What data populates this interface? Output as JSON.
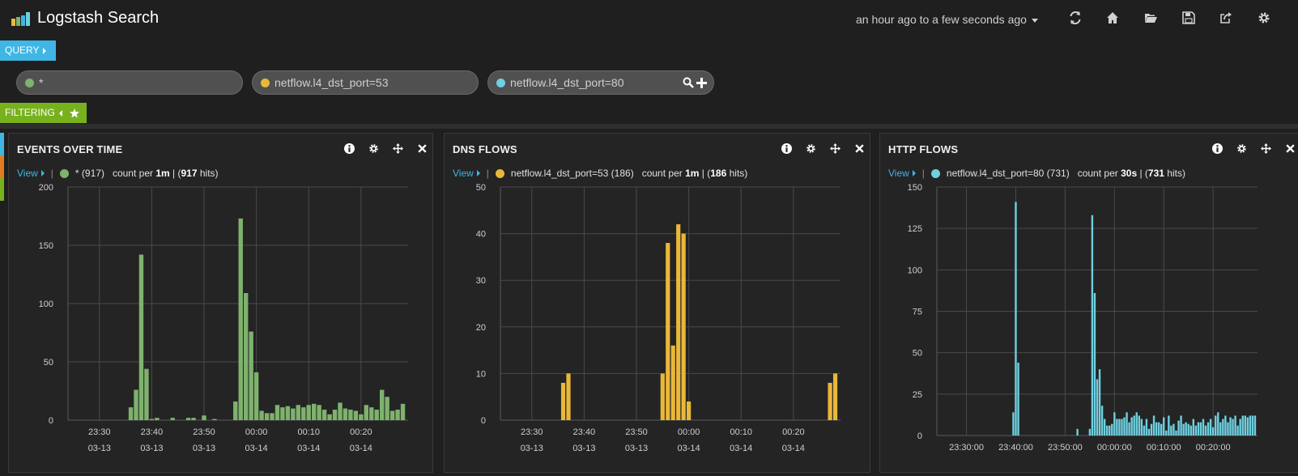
{
  "app": {
    "title": "Logstash Search"
  },
  "timepicker": {
    "label": "an hour ago to a few seconds ago"
  },
  "nav_icons": [
    "refresh-icon",
    "home-icon",
    "folder-open-icon",
    "save-icon",
    "share-icon",
    "gear-icon"
  ],
  "rows": {
    "query_label": "QUERY",
    "filtering_label": "FILTERING"
  },
  "queries": [
    {
      "text": "*",
      "color": "#7eb26d"
    },
    {
      "text": "netflow.l4_dst_port=53",
      "color": "#eab839"
    },
    {
      "text": "netflow.l4_dst_port=80",
      "color": "#6ed0e0"
    }
  ],
  "colors": {
    "query_accent": "#3fb6e4",
    "filter_accent": "#78b11e",
    "row_strip": [
      "#3fb6e4",
      "#e17b1f",
      "#78b11e"
    ]
  },
  "panels": [
    {
      "title": "EVENTS OVER TIME",
      "legend": {
        "view": "View",
        "series": "* (917)",
        "count_prefix": "count per",
        "interval": "1m",
        "hits_open": "(",
        "hits": "917",
        "hits_suffix": "hits)"
      }
    },
    {
      "title": "DNS FLOWS",
      "legend": {
        "view": "View",
        "series": "netflow.l4_dst_port=53 (186)",
        "count_prefix": "count per",
        "interval": "1m",
        "hits_open": "(",
        "hits": "186",
        "hits_suffix": "hits)"
      }
    },
    {
      "title": "HTTP FLOWS",
      "legend": {
        "view": "View",
        "series": "netflow.l4_dst_port=80 (731)",
        "count_prefix": "count per",
        "interval": "30s",
        "hits_open": "(",
        "hits": "731",
        "hits_suffix": "hits)"
      }
    }
  ],
  "chart_data": [
    {
      "type": "bar",
      "title": "EVENTS OVER TIME",
      "color": "#7eb26d",
      "ylim": [
        0,
        200
      ],
      "yticks": [
        0,
        50,
        100,
        150,
        200
      ],
      "xlim": [
        -6,
        59
      ],
      "xticks": [
        {
          "x": 0,
          "label": "23:30",
          "sub": "03-13"
        },
        {
          "x": 10,
          "label": "23:40",
          "sub": "03-13"
        },
        {
          "x": 20,
          "label": "23:50",
          "sub": "03-13"
        },
        {
          "x": 30,
          "label": "00:00",
          "sub": "03-14"
        },
        {
          "x": 40,
          "label": "00:10",
          "sub": "03-14"
        },
        {
          "x": 50,
          "label": "00:20",
          "sub": "03-14"
        }
      ],
      "x": [
        6,
        7,
        8,
        9,
        10,
        11,
        14,
        17,
        18,
        20,
        22,
        26,
        27,
        28,
        29,
        30,
        31,
        32,
        33,
        34,
        35,
        36,
        37,
        38,
        39,
        40,
        41,
        42,
        43,
        44,
        45,
        46,
        47,
        48,
        49,
        50,
        51,
        52,
        53,
        54,
        55,
        56,
        57,
        58
      ],
      "values": [
        11,
        26,
        142,
        44,
        1,
        2,
        2,
        2,
        2,
        4,
        1,
        16,
        173,
        109,
        76,
        41,
        8,
        6,
        6,
        13,
        11,
        12,
        10,
        13,
        11,
        13,
        14,
        13,
        9,
        5,
        9,
        15,
        10,
        9,
        8,
        5,
        13,
        11,
        9,
        26,
        20,
        8,
        9,
        14
      ]
    },
    {
      "type": "bar",
      "title": "DNS FLOWS",
      "color": "#eab839",
      "ylim": [
        0,
        50
      ],
      "yticks": [
        0,
        10,
        20,
        30,
        40,
        50
      ],
      "xlim": [
        -6,
        59
      ],
      "xticks": [
        {
          "x": 0,
          "label": "23:30",
          "sub": "03-13"
        },
        {
          "x": 10,
          "label": "23:40",
          "sub": "03-13"
        },
        {
          "x": 20,
          "label": "23:50",
          "sub": "03-13"
        },
        {
          "x": 30,
          "label": "00:00",
          "sub": "03-14"
        },
        {
          "x": 40,
          "label": "00:10",
          "sub": "03-14"
        },
        {
          "x": 50,
          "label": "00:20",
          "sub": "03-14"
        }
      ],
      "x": [
        6,
        7,
        25,
        26,
        27,
        28,
        29,
        30,
        57,
        58
      ],
      "values": [
        8,
        10,
        10,
        38,
        16,
        42,
        40,
        4,
        8,
        10
      ]
    },
    {
      "type": "bar",
      "title": "HTTP FLOWS",
      "color": "#6ed0e0",
      "ylim": [
        0,
        150
      ],
      "yticks": [
        0,
        25,
        50,
        75,
        100,
        125,
        150
      ],
      "xlim": [
        -6,
        59
      ],
      "xticks": [
        {
          "x": 0,
          "label": "23:30:00"
        },
        {
          "x": 10,
          "label": "23:40:00"
        },
        {
          "x": 20,
          "label": "23:50:00"
        },
        {
          "x": 30,
          "label": "00:00:00"
        },
        {
          "x": 40,
          "label": "00:10:00"
        },
        {
          "x": 50,
          "label": "00:20:00"
        }
      ],
      "x": [
        9.5,
        10,
        10.5,
        22.5,
        25,
        25.5,
        26,
        26.5,
        27,
        27.5,
        28,
        28.5,
        29,
        29.5,
        30,
        30.5,
        31,
        31.5,
        32,
        32.5,
        33,
        33.5,
        34,
        34.5,
        35,
        35.5,
        36,
        36.5,
        37,
        37.5,
        38,
        38.5,
        39,
        39.5,
        40,
        40.5,
        41,
        41.5,
        42,
        42.5,
        43,
        43.5,
        44,
        44.5,
        45,
        45.5,
        46,
        46.5,
        47,
        47.5,
        48,
        48.5,
        49,
        49.5,
        50,
        50.5,
        51,
        51.5,
        52,
        52.5,
        53,
        53.5,
        54,
        54.5,
        55,
        55.5,
        56,
        56.5,
        57,
        57.5,
        58,
        58.5
      ],
      "values": [
        14,
        141,
        44,
        4,
        4,
        133,
        86,
        34,
        40,
        18,
        10,
        6,
        6,
        7,
        14,
        10,
        10,
        10,
        11,
        14,
        8,
        11,
        12,
        14,
        12,
        10,
        6,
        10,
        4,
        7,
        12,
        8,
        8,
        7,
        11,
        3,
        12,
        6,
        7,
        3,
        9,
        12,
        7,
        8,
        7,
        6,
        10,
        6,
        8,
        8,
        10,
        6,
        8,
        10,
        5,
        12,
        14,
        8,
        10,
        12,
        8,
        11,
        10,
        12,
        6,
        10,
        12,
        12,
        11,
        12,
        12,
        12
      ]
    }
  ]
}
